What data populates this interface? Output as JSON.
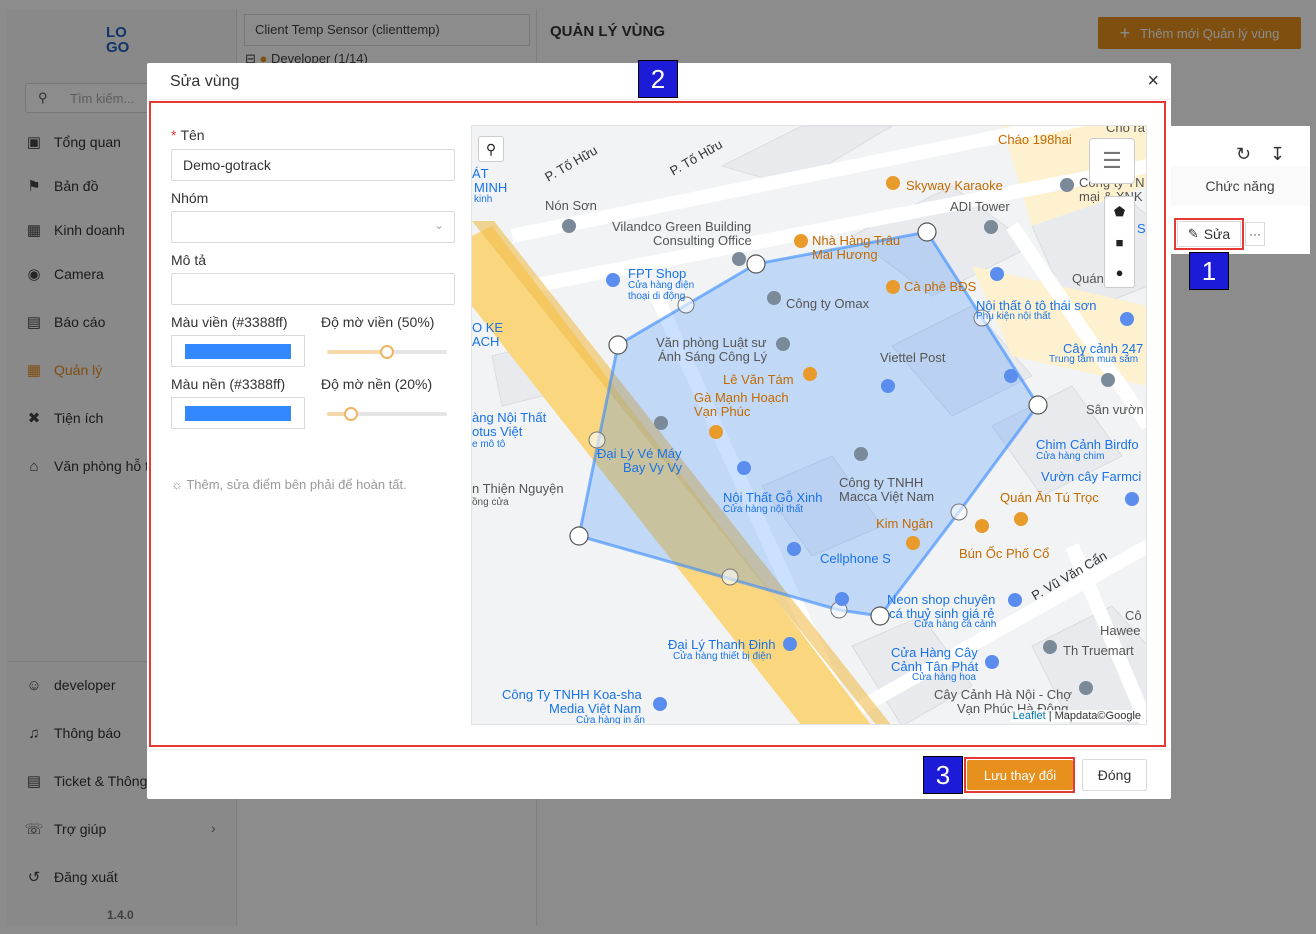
{
  "sidebar": {
    "logo_top": "LO",
    "logo_bottom": "GO",
    "search_placeholder": "Tìm kiếm...",
    "items": [
      {
        "label": "Tổng quan",
        "icon": "dashboard-icon"
      },
      {
        "label": "Bản đồ",
        "icon": "map-icon"
      },
      {
        "label": "Kinh doanh",
        "icon": "business-icon"
      },
      {
        "label": "Camera",
        "icon": "camera-icon"
      },
      {
        "label": "Báo cáo",
        "icon": "report-icon"
      },
      {
        "label": "Quản lý",
        "icon": "manage-icon",
        "active": true
      },
      {
        "label": "Tiện ích",
        "icon": "tools-icon"
      },
      {
        "label": "Văn phòng hỗ t",
        "icon": "office-icon"
      }
    ],
    "bottom_items": [
      {
        "label": "developer",
        "icon": "user-icon"
      },
      {
        "label": "Thông báo",
        "icon": "bell-icon"
      },
      {
        "label": "Ticket & Thông",
        "icon": "ticket-icon"
      },
      {
        "label": "Trợ giúp",
        "icon": "headset-icon"
      },
      {
        "label": "Đăng xuất",
        "icon": "logout-icon"
      }
    ],
    "version": "1.4.0"
  },
  "midcol": {
    "client_select": "Client Temp Sensor (clienttemp)",
    "tree_node": "Developer (1/14)"
  },
  "main": {
    "title": "QUẢN LÝ VÙNG",
    "add_button": "Thêm mới Quản lý vùng",
    "column_actions": "Chức năng",
    "edit_button": "Sửa",
    "more_button": "···"
  },
  "modal": {
    "title": "Sửa vùng",
    "close": "×",
    "name_label": "Tên",
    "name_value": "Demo-gotrack",
    "group_label": "Nhóm",
    "group_value": "",
    "desc_label": "Mô tả",
    "desc_value": "",
    "border_color_label": "Màu viền (#3388ff)",
    "border_opacity_label": "Độ mờ viền (50%)",
    "fill_color_label": "Màu nền (#3388ff)",
    "fill_opacity_label": "Độ mờ nền (20%)",
    "border_color": "#3388ff",
    "fill_color": "#3388ff",
    "border_opacity": 0.5,
    "fill_opacity": 0.2,
    "hint": "Thêm, sửa điểm bên phải để hoàn tất.",
    "save_button": "Lưu thay đổi",
    "close_button": "Đóng"
  },
  "map": {
    "attribution_leaflet": "Leaflet",
    "attribution_rest": "| Mapdata©Google",
    "labels": [
      "P. Tố Hữu",
      "P. Tố Hữu",
      "Nón Sơn",
      "Vilandco Green Building",
      "Consulting Office",
      "Nhà Hàng Trâu",
      "Mai Hương",
      "Skyway Karaoke",
      "ADI Tower",
      "Cháo 198hai",
      "FPT Shop",
      "Cửa hàng điện",
      "thoại di động",
      "Công ty Omax",
      "Cà phê BĐS",
      "Nội thất ô tô thái sơn",
      "Phụ kiện nội thất",
      "Văn phòng Luật sư",
      "Ánh Sáng Công Lý",
      "Viettel Post",
      "Cây cảnh 247",
      "Trung tâm mua sắm",
      "Lê Văn Tám",
      "Gà Mạnh Hoạch",
      "Vạn Phúc",
      "Sân vườn",
      "àng Nội Thất",
      "otus Việt",
      "e mô tô",
      "Đại Lý Vé Máy",
      "Bay Vy Vy",
      "Công ty TNHH",
      "Macca Việt Nam",
      "Chim Cảnh Birdfo",
      "Cửa hàng chim",
      "Vườn cây Farmci",
      "Quán Ăn Tú Trọc",
      "Nội Thất Gỗ Xinh",
      "Cửa hàng nội thất",
      "n Thiện Nguyện",
      "ồng cửa",
      "Kim Ngân",
      "Bún Ốc Phố Cổ",
      "Cellphone S",
      "P. Vũ Văn Cẩn",
      "Neon shop chuyên",
      "cá thuỷ sinh giá rẻ",
      "Cửa hàng cá cảnh",
      "Cô",
      "Hawee",
      "Th Truemart",
      "Đại Lý Thanh Đinh",
      "Cửa hàng thiết bị điện",
      "Cửa Hàng Cây",
      "Cảnh Tân Phát",
      "Cửa hàng hoa",
      "Công Ty TNHH Koa-sha",
      "Media Việt Nam",
      "Cửa hàng in ấn",
      "Cây Cảnh Hà Nội - Chợ",
      "Vạn Phúc Hà Đông",
      "ÁT",
      "MINH",
      "kinh",
      "O KE",
      "ACH",
      "Công ty TN",
      "mại & XNK",
      "Quán",
      "Chỏ ra",
      "S"
    ]
  },
  "annotations": {
    "badge1": "1",
    "badge2": "2",
    "badge3": "3"
  }
}
